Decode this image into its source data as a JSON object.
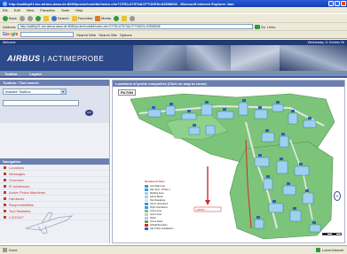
{
  "window": {
    "title": "http://sa8fnp01.toe.airbus.dasa.de:8080/probe/lookitbl/index.cfm?CFID=67574&CFTOKEN=92558008 - Microsoft Internet Explorer Jam"
  },
  "menu": [
    "Ele",
    "Edit",
    "View",
    "Favorites",
    "Tools",
    "Help"
  ],
  "toolbar": {
    "back": "Back",
    "search": "Search",
    "favorites": "Favorites",
    "media": "Media"
  },
  "address": {
    "label": "Address",
    "url": "http://sa8fnp01.toe.airbus.dasa.de:8080/probe/lookitbl/index.cfm?CFID=67574&CFTOKEN=92558008",
    "go": "Go",
    "links": "Links"
  },
  "googlebar": {
    "logo": "Google",
    "search_web": "Search Web",
    "search_site": "Search Site",
    "options": "Options"
  },
  "site": {
    "welcome": "Welcome",
    "date": "Wednesday 11 October 06",
    "logo": "AIRBUS",
    "product": "ACTIMEPROBE",
    "nav": [
      "Toolbar",
      "Logout"
    ]
  },
  "left": {
    "search_head": "Toolbox / Tool search",
    "select_value": "Inactive Toolbox",
    "go_label": "GO",
    "navigation_head": "Navigation",
    "nav_items": [
      "Locations",
      "Messages",
      "Overview",
      "IP Addresses",
      "Active Probe Machines",
      "Hardware",
      "Responsibilities",
      "Tool Statistics",
      "LOGOUT"
    ]
  },
  "map": {
    "head": "Locations of probe computers (Click on map to zoom)",
    "site_label": "FILTON",
    "legend_head": "Numbered Sites",
    "legend": [
      {
        "label": "Actr Flight Lab",
        "color": "#2aa0d8"
      },
      {
        "label": "Site Zone - Phase 1",
        "color": "#2aa0d8"
      },
      {
        "label": "Building Area",
        "color": "#9fd0ef"
      },
      {
        "label": "Admin Block",
        "color": "#9fd0ef"
      },
      {
        "label": "Site Roadways",
        "color": "#dddddd"
      },
      {
        "label": "Storm Operations",
        "color": "#2aa0d8"
      },
      {
        "label": "Flight Operations",
        "color": "#2aa0d8"
      },
      {
        "label": "Grass Area",
        "color": "#7cc47a"
      },
      {
        "label": "Apron Area",
        "color": "#c8c8c8"
      },
      {
        "label": "Water",
        "color": "#9fd0ef"
      },
      {
        "label": "Fence Road",
        "color": "#7a9a4a"
      },
      {
        "label": "Airfield Boundary",
        "color": "#d22a2a"
      },
      {
        "label": "Site Probe Installations",
        "color": "#2e5fbf"
      }
    ],
    "marker_label": "ARIMO ...",
    "compass": "N"
  },
  "status": {
    "left": "Done",
    "right": "Local intranet"
  }
}
